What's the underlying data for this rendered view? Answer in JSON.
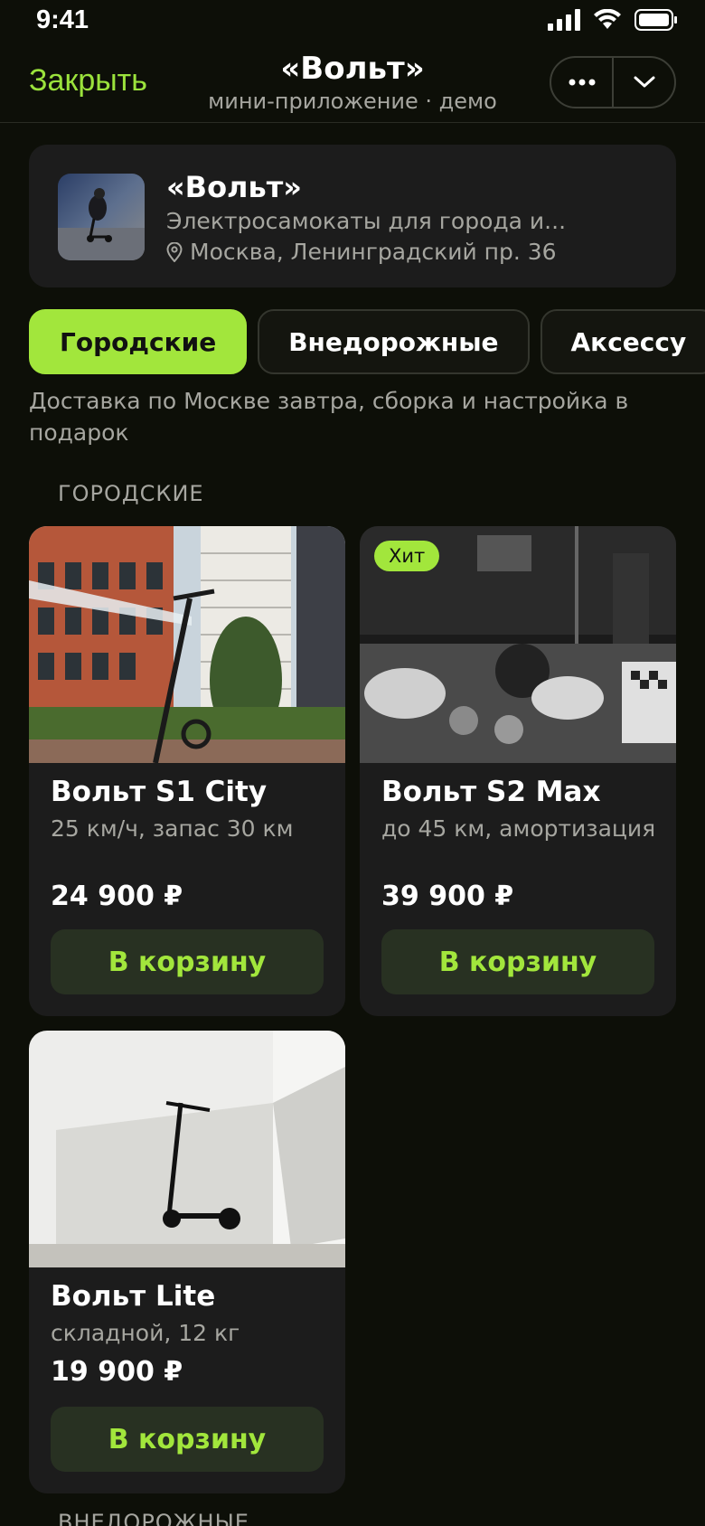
{
  "status": {
    "time": "9:41"
  },
  "nav": {
    "close_label": "Закрыть",
    "title": "«Вольт»",
    "subtitle": "мини-приложение · демо"
  },
  "shop": {
    "name": "«Вольт»",
    "description": "Электросамокаты для города и...",
    "address": "Москва, Ленинградский пр. 36"
  },
  "tabs": [
    {
      "label": "Городские",
      "active": true
    },
    {
      "label": "Внедорожные",
      "active": false
    },
    {
      "label": "Аксессу",
      "active": false
    }
  ],
  "delivery_note": "Доставка по Москве завтра, сборка и настройка в подарок",
  "section_title": "ГОРОДСКИЕ",
  "products": [
    {
      "name": "Вольт S1 City",
      "spec": "25 км/ч, запас 30 км",
      "price": "24 900 ₽",
      "button": "В корзину",
      "badge": ""
    },
    {
      "name": "Вольт S2 Max",
      "spec": "до 45 км, амортизация",
      "price": "39 900 ₽",
      "button": "В корзину",
      "badge": "Хит"
    },
    {
      "name": "Вольт Lite",
      "spec": "складной, 12 кг",
      "price": "19 900 ₽",
      "button": "В корзину",
      "badge": ""
    }
  ],
  "next_section_title": "ВНЕДОРОЖНЫЕ",
  "colors": {
    "accent": "#a2e63c",
    "background": "#0d0f08",
    "card": "#1c1c1c"
  }
}
